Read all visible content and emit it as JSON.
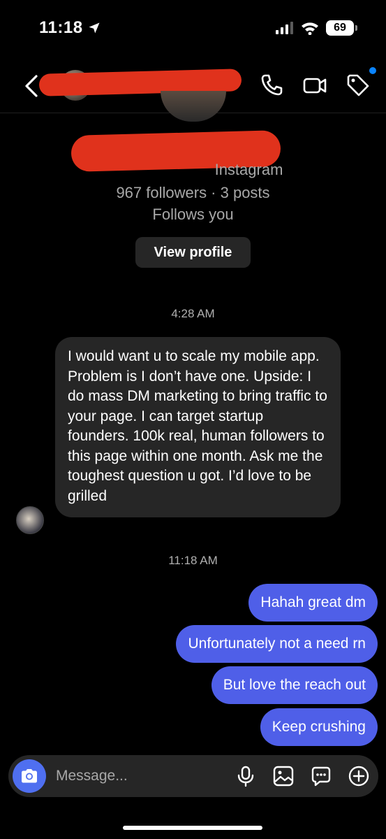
{
  "status_bar": {
    "time": "11:18",
    "battery": "69",
    "icons": [
      "location-arrow-icon",
      "signal-icon",
      "wifi-icon",
      "battery-icon"
    ]
  },
  "header": {
    "icons": [
      "back-icon",
      "phone-icon",
      "video-icon",
      "tag-icon"
    ],
    "notification_dot_color": "#0a84ff"
  },
  "profile": {
    "source_label": "Instagram",
    "stats": "967 followers · 3 posts",
    "follow_status": "Follows you",
    "view_profile_label": "View profile"
  },
  "conversation": {
    "timestamp_1": "4:28 AM",
    "incoming_message": "I would want u to scale my mobile app. Problem is I don’t have one. Upside: I do mass DM marketing to bring traffic to your page. I can target startup founders. 100k real, human followers to this page within one month. Ask me the toughest question u got. I’d love to be grilled",
    "timestamp_2": "11:18 AM",
    "outgoing_messages": [
      "Hahah great dm",
      "Unfortunately not a need rn",
      "But love the reach out",
      "Keep crushing"
    ]
  },
  "composer": {
    "placeholder": "Message...",
    "icons": [
      "camera-icon",
      "microphone-icon",
      "image-icon",
      "sticker-chat-icon",
      "plus-circle-icon"
    ]
  },
  "colors": {
    "background": "#000000",
    "incoming_bubble": "#262626",
    "outgoing_bubble": "#4f5fe8",
    "redaction": "#e0321c"
  }
}
